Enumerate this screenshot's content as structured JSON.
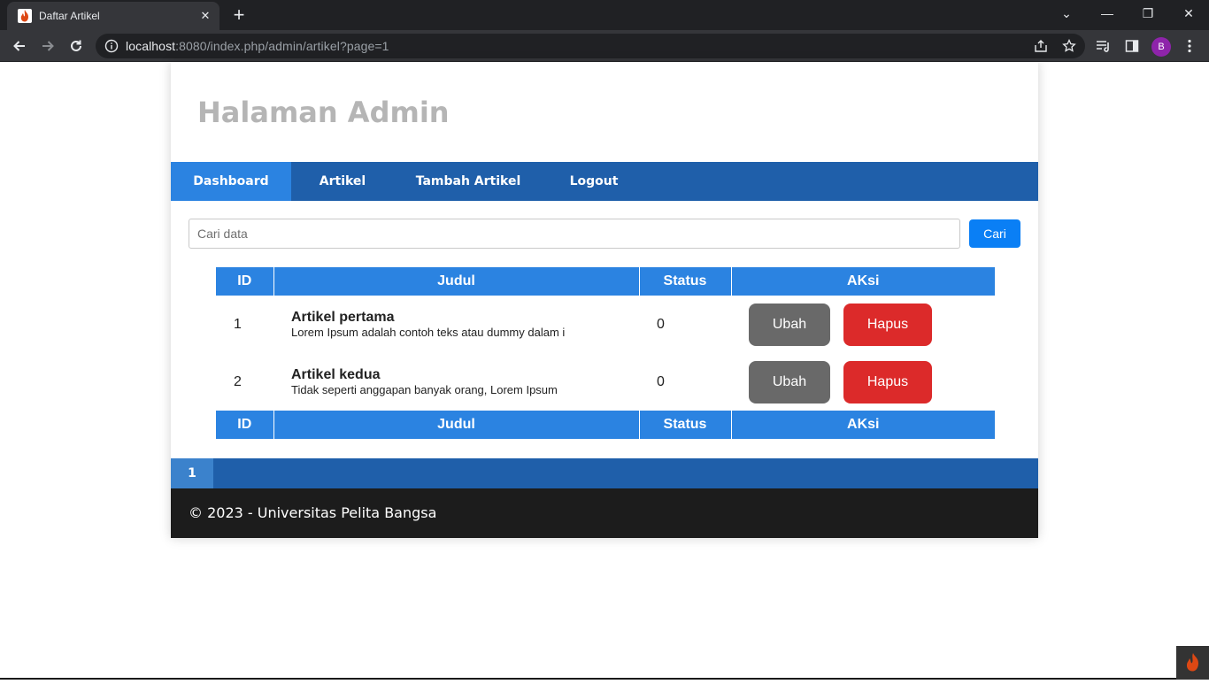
{
  "browser": {
    "tab_title": "Daftar Artikel",
    "tab_close": "✕",
    "new_tab": "+",
    "url_host": "localhost",
    "url_rest": ":8080/index.php/admin/artikel?page=1",
    "profile_initial": "B",
    "profile_color": "#8e24aa",
    "window_controls": {
      "chevron": "⌄",
      "minimize": "—",
      "restore": "❐",
      "close": "✕"
    }
  },
  "page": {
    "site_title": "Halaman Admin",
    "nav": [
      {
        "label": "Dashboard",
        "active": true
      },
      {
        "label": "Artikel",
        "active": false
      },
      {
        "label": "Tambah Artikel",
        "active": false
      },
      {
        "label": "Logout",
        "active": false
      }
    ],
    "search": {
      "placeholder": "Cari data",
      "value": "",
      "button_label": "Cari"
    },
    "table": {
      "headers": [
        "ID",
        "Judul",
        "Status",
        "AKsi"
      ],
      "rows": [
        {
          "id": "1",
          "title": "Artikel pertama",
          "excerpt": "Lorem Ipsum adalah contoh teks atau dummy dalam i",
          "status": "0",
          "edit_label": "Ubah",
          "delete_label": "Hapus"
        },
        {
          "id": "2",
          "title": "Artikel kedua",
          "excerpt": "Tidak seperti anggapan banyak orang, Lorem Ipsum",
          "status": "0",
          "edit_label": "Ubah",
          "delete_label": "Hapus"
        }
      ]
    },
    "pagination": {
      "current_page": "1"
    },
    "footer": "© 2023 - Universitas Pelita Bangsa"
  },
  "colors": {
    "nav_bg": "#1f5faa",
    "nav_active": "#2b83e1",
    "table_header": "#2b83e1",
    "search_button": "#0a7ff5",
    "edit_button": "#696969",
    "delete_button": "#dc2a2a",
    "footer_bg": "#1c1c1c",
    "title_color": "#b5b5b5"
  }
}
